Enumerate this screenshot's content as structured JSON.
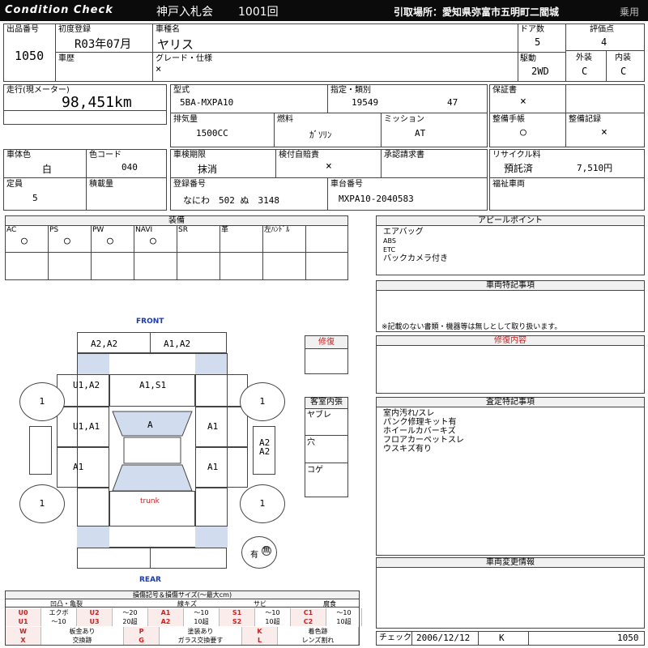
{
  "header": {
    "brand": "Condition Check",
    "auction": "神戸入札会",
    "lot": "1001回",
    "pickup": "引取場所：愛知県弥富市五明町二閻城",
    "category": "乗用"
  },
  "row1": {
    "lot_no_label": "出品番号",
    "lot_no": "1050",
    "first_reg_label": "初度登録",
    "first_reg": "R03年07月",
    "car_name_label": "車種名",
    "car_name": "ヤリス",
    "history_label": "車歴",
    "grade_label": "グレード・仕様",
    "grade": "×",
    "doors_label": "ドア数",
    "doors": "5",
    "drive_label": "駆動",
    "drive": "2WD",
    "score_label": "評価点",
    "score": "4",
    "exterior_label": "外装",
    "exterior": "C",
    "interior_label": "内装",
    "interior": "C"
  },
  "row2": {
    "mileage_label": "走行(現メーター)",
    "mileage": "98,451km",
    "model_label": "型式",
    "model": "5BA-MXPA10",
    "designation_label": "指定・類別",
    "designation": "19549",
    "category_no": "47",
    "displacement_label": "排気量",
    "displacement": "1500CC",
    "fuel_label": "燃料",
    "fuel": "ｶﾞｿﾘﾝ",
    "mission_label": "ミッション",
    "mission": "AT",
    "warranty_label": "保証書",
    "warranty": "×",
    "manual_label": "整備手帳",
    "manual": "○",
    "record_label": "整備記録",
    "record": "×"
  },
  "row3": {
    "color_label": "車体色",
    "color": "白",
    "color_code_label": "色コード",
    "color_code": "040",
    "inspection_label": "車検期限",
    "inspection": "抹消",
    "insurance_label": "検付自賠責",
    "insurance": "×",
    "approval_label": "承認請求書",
    "recycle_label": "リサイクル料",
    "recycle_status": "預託済",
    "recycle_fee": "7,510円",
    "capacity_label": "定員",
    "capacity": "5",
    "load_label": "積載量",
    "plate_label": "登録番号",
    "plate": "なにわ　502 ぬ　3148",
    "chassis_label": "車台番号",
    "chassis": "MXPA10-2040583",
    "welfare_label": "福祉車両"
  },
  "equipment": {
    "title": "装備",
    "items": [
      {
        "label": "AC",
        "value": "○"
      },
      {
        "label": "PS",
        "value": "○"
      },
      {
        "label": "PW",
        "value": "○"
      },
      {
        "label": "NAVI",
        "value": "○"
      },
      {
        "label": "SR",
        "value": ""
      },
      {
        "label": "革",
        "value": ""
      },
      {
        "label": "左ﾊﾝﾄﾞﾙ",
        "value": ""
      }
    ]
  },
  "appeal": {
    "title": "アピールポイント",
    "lines": [
      "エアバッグ",
      "ABS",
      "ETC",
      "バックカメラ付き"
    ]
  },
  "special": {
    "title": "車両特記事項",
    "note": "※記載のない書類・機器等は無しとして取り扱います。"
  },
  "repair_content": {
    "title": "修復内容"
  },
  "inspector_notes": {
    "title": "査定特記事項",
    "lines": [
      "室内汚れ/スレ",
      "パンク修理キット有",
      "ホイールカバーキズ",
      "フロアカーペットスレ",
      "ウスキズ有り"
    ]
  },
  "change_info": {
    "title": "車両変更情報"
  },
  "diagram": {
    "front": "FRONT",
    "rear": "REAR",
    "trunk": "trunk",
    "tire": "1",
    "spare_tire": "有",
    "spare_tire_sub": "無",
    "codes": {
      "front_left": "A2,A2",
      "front_right": "A1,A2",
      "hood_left": "U1,A2",
      "hood_center": "A1,S1",
      "door_fl": "U1,A1",
      "roof_front": "A",
      "door_fr": "A1",
      "door_rl": "A1",
      "door_rr": "A1",
      "side_right": "A2\nA2"
    }
  },
  "side_boxes": {
    "repair_title": "修復",
    "interior_title": "客室内張",
    "interior_items": [
      "ヤブレ",
      "穴",
      "コゲ"
    ]
  },
  "legend": {
    "title": "損傷記号＆損傷サイズ(〜最大cm)",
    "groups": [
      "凹凸・亀裂",
      "線キズ",
      "サビ",
      "腐食"
    ],
    "row1": [
      "U0",
      "エクボ",
      "U2",
      "〜20",
      "A1",
      "〜10",
      "S1",
      "〜10",
      "C1",
      "〜10"
    ],
    "row2": [
      "U1",
      "〜10",
      "U3",
      "20超",
      "A2",
      "10超",
      "S2",
      "10超",
      "C2",
      "10超"
    ],
    "row3": [
      "W",
      "板金あり",
      "P",
      "塗装あり",
      "K",
      "着色跡"
    ],
    "row4": [
      "X",
      "交換跡",
      "G",
      "ガラス交換要す",
      "L",
      "レンズ割れ"
    ]
  },
  "check": {
    "label": "チェック",
    "date": "2006/12/12",
    "code": "K",
    "lot": "1050"
  },
  "colors": {
    "header_bg": "#0b0b0b",
    "accent_red": "#cc2020",
    "front_blue": "#1a3bb0",
    "shade_blue": "#d2dcef"
  }
}
